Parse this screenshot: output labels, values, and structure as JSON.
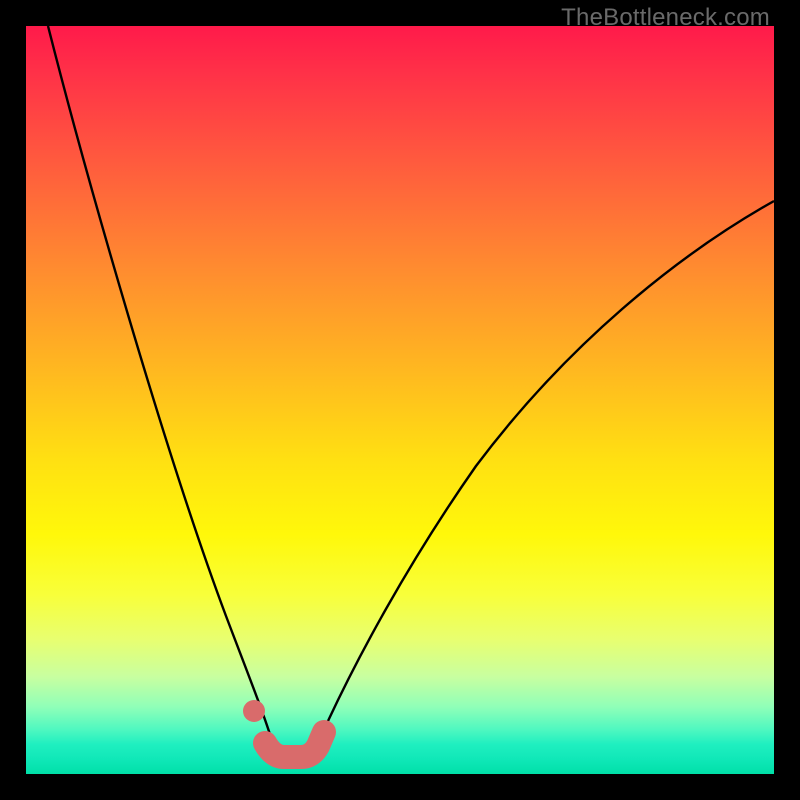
{
  "watermark": "TheBottleneck.com",
  "colors": {
    "background": "#000000",
    "gradient_top": "#ff1a4a",
    "gradient_bottom": "#00e0a8",
    "curve": "#000000",
    "marker": "#d96b6b"
  },
  "chart_data": {
    "type": "line",
    "title": "",
    "xlabel": "",
    "ylabel": "",
    "xlim": [
      0,
      100
    ],
    "ylim": [
      0,
      100
    ],
    "note": "Axes and units are not labeled in the source image; x and y are read as percentages of plot width/height with y=0 at bottom. Values estimated from pixel positions.",
    "series": [
      {
        "name": "left-branch",
        "x": [
          3,
          6,
          10,
          14,
          18,
          22,
          25,
          27,
          29,
          30.5,
          32,
          33
        ],
        "y": [
          100,
          86,
          70,
          54,
          40,
          27,
          17,
          11,
          7,
          4.5,
          3,
          2.3
        ]
      },
      {
        "name": "right-branch",
        "x": [
          38,
          40,
          43,
          47,
          52,
          58,
          65,
          73,
          82,
          91,
          100
        ],
        "y": [
          2.3,
          4,
          9,
          17,
          27,
          38,
          49,
          58,
          66,
          72,
          77
        ]
      }
    ],
    "markers": {
      "name": "salmon-highlight",
      "description": "Thick salmon-colored dotted/rounded stroke near the curve minimum plus one detached dot on the left branch slightly above it.",
      "detached_point": {
        "x": 30.5,
        "y": 8.5
      },
      "bottom_path": [
        {
          "x": 32.0,
          "y": 4.1
        },
        {
          "x": 33.0,
          "y": 2.8
        },
        {
          "x": 34.5,
          "y": 2.3
        },
        {
          "x": 36.5,
          "y": 2.3
        },
        {
          "x": 38.0,
          "y": 2.8
        },
        {
          "x": 39.0,
          "y": 4.1
        },
        {
          "x": 39.8,
          "y": 5.6
        }
      ]
    }
  }
}
